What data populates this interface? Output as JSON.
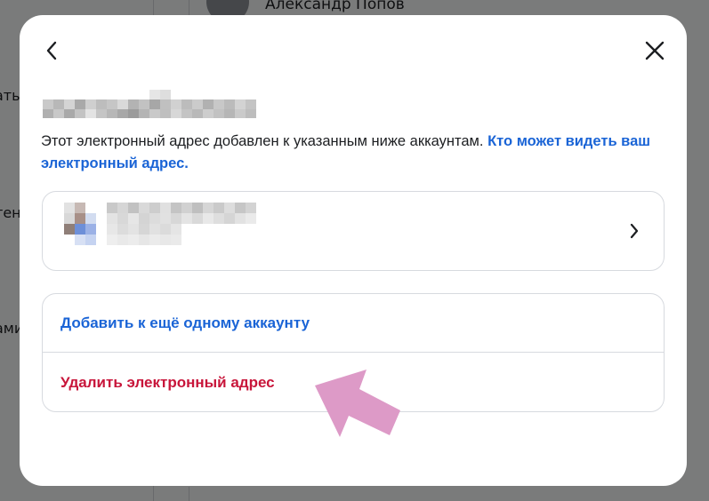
{
  "background": {
    "user_name": "Александр Попов",
    "left_fragments": [
      "ать",
      "тен",
      "ами"
    ]
  },
  "modal": {
    "back_icon": "chevron-left-icon",
    "close_icon": "close-icon",
    "description": "Этот электронный адрес добавлен к указанным ниже аккаунтам.",
    "description_link": "Кто может видеть ваш электронный адрес.",
    "account_chevron_icon": "chevron-right-icon",
    "actions": {
      "add_label": "Добавить к ещё одному аккаунту",
      "remove_label": "Удалить электронный адрес"
    }
  },
  "colors": {
    "link": "#1a64d6",
    "danger": "#c8153a",
    "annotation_arrow": "#dd9ac7"
  }
}
